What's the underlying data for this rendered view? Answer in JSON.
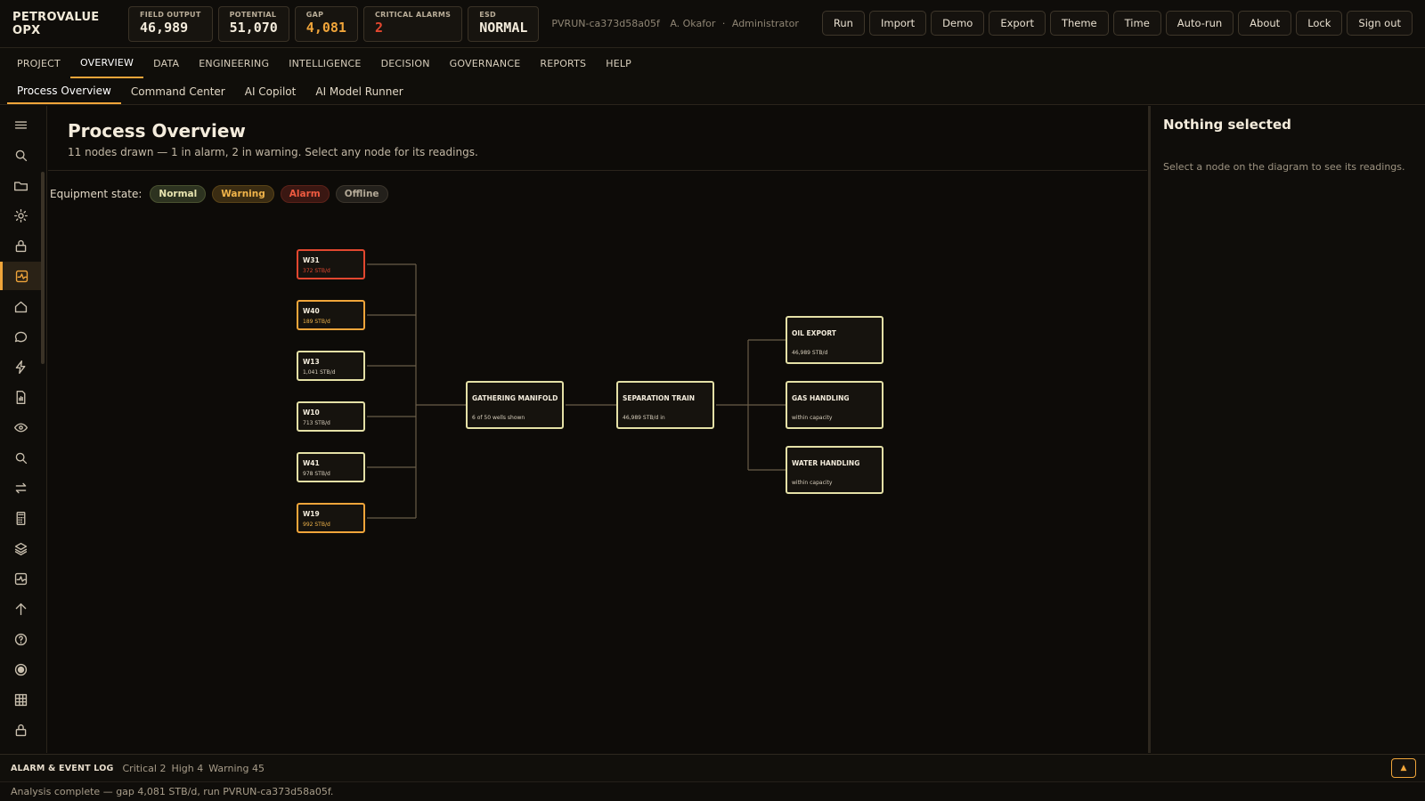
{
  "app": {
    "brand": "PETROVALUE OPX"
  },
  "kpis": [
    {
      "label": "FIELD OUTPUT",
      "value": "46,989",
      "tone": "normal"
    },
    {
      "label": "POTENTIAL",
      "value": "51,070",
      "tone": "normal"
    },
    {
      "label": "GAP",
      "value": "4,081",
      "tone": "orange"
    },
    {
      "label": "CRITICAL ALARMS",
      "value": "2",
      "tone": "red"
    },
    {
      "label": "ESD",
      "value": "NORMAL",
      "tone": "normal"
    }
  ],
  "run": {
    "id": "PVRUN-ca373d58a05f",
    "user": "A. Okafor",
    "sep": "·",
    "role": "Administrator"
  },
  "actions": [
    "Run",
    "Import",
    "Demo",
    "Export",
    "Theme",
    "Time",
    "Auto-run",
    "About",
    "Lock",
    "Sign out"
  ],
  "main_nav": [
    "PROJECT",
    "OVERVIEW",
    "DATA",
    "ENGINEERING",
    "INTELLIGENCE",
    "DECISION",
    "GOVERNANCE",
    "REPORTS",
    "HELP"
  ],
  "main_nav_active": "OVERVIEW",
  "sub_nav": [
    "Process Overview",
    "Command Center",
    "AI Copilot",
    "AI Model Runner"
  ],
  "sub_nav_active": "Process Overview",
  "sidebar_icons": [
    "menu-icon",
    "search-icon",
    "folder-icon",
    "gear-icon",
    "lock-icon",
    "activity-icon",
    "home-icon",
    "chat-icon",
    "bolt-icon",
    "report-icon",
    "eye-icon",
    "magnifier-icon",
    "swap-icon",
    "calculator-icon",
    "layers-icon",
    "pulse-icon",
    "arrow-up-icon",
    "help-icon",
    "record-icon",
    "grid-icon",
    "lock-icon"
  ],
  "page": {
    "title": "Process Overview",
    "subtitle": "11 nodes drawn — 1 in alarm, 2 in warning. Select any node for its readings."
  },
  "legend": {
    "label": "Equipment state:",
    "states": [
      {
        "label": "Normal",
        "kind": "normal"
      },
      {
        "label": "Warning",
        "kind": "warning"
      },
      {
        "label": "Alarm",
        "kind": "alarm"
      },
      {
        "label": "Offline",
        "kind": "offline"
      }
    ]
  },
  "nodes": {
    "wells": [
      {
        "name": "W31",
        "reading": "372 STB/d",
        "state": "alarm"
      },
      {
        "name": "W40",
        "reading": "189 STB/d",
        "state": "warning"
      },
      {
        "name": "W13",
        "reading": "1,041 STB/d",
        "state": "normal"
      },
      {
        "name": "W10",
        "reading": "713 STB/d",
        "state": "normal"
      },
      {
        "name": "W41",
        "reading": "978 STB/d",
        "state": "normal"
      },
      {
        "name": "W19",
        "reading": "992 STB/d",
        "state": "warning"
      }
    ],
    "manifold": {
      "name": "GATHERING MANIFOLD",
      "reading": "6 of 50 wells shown",
      "state": "normal"
    },
    "separator": {
      "name": "SEPARATION TRAIN",
      "reading": "46,989 STB/d in",
      "state": "normal"
    },
    "outputs": [
      {
        "name": "OIL EXPORT",
        "reading": "46,989 STB/d",
        "state": "normal"
      },
      {
        "name": "GAS HANDLING",
        "reading": "within capacity",
        "state": "normal"
      },
      {
        "name": "WATER HANDLING",
        "reading": "within capacity",
        "state": "normal"
      }
    ]
  },
  "inspector": {
    "title": "Nothing selected",
    "text": "Select a node on the diagram to see its readings."
  },
  "log": {
    "title": "ALARM & EVENT LOG",
    "critical": "Critical 2",
    "high": "High 4",
    "warning": "Warning 45",
    "toggle": "▲"
  },
  "status": "Analysis complete — gap 4,081 STB/d, run PVRUN-ca373d58a05f.",
  "colors": {
    "accent": "#f0a53a",
    "alarm": "#e2472f",
    "normal_border": "#e4e0a6",
    "background": "#0d0b08"
  }
}
